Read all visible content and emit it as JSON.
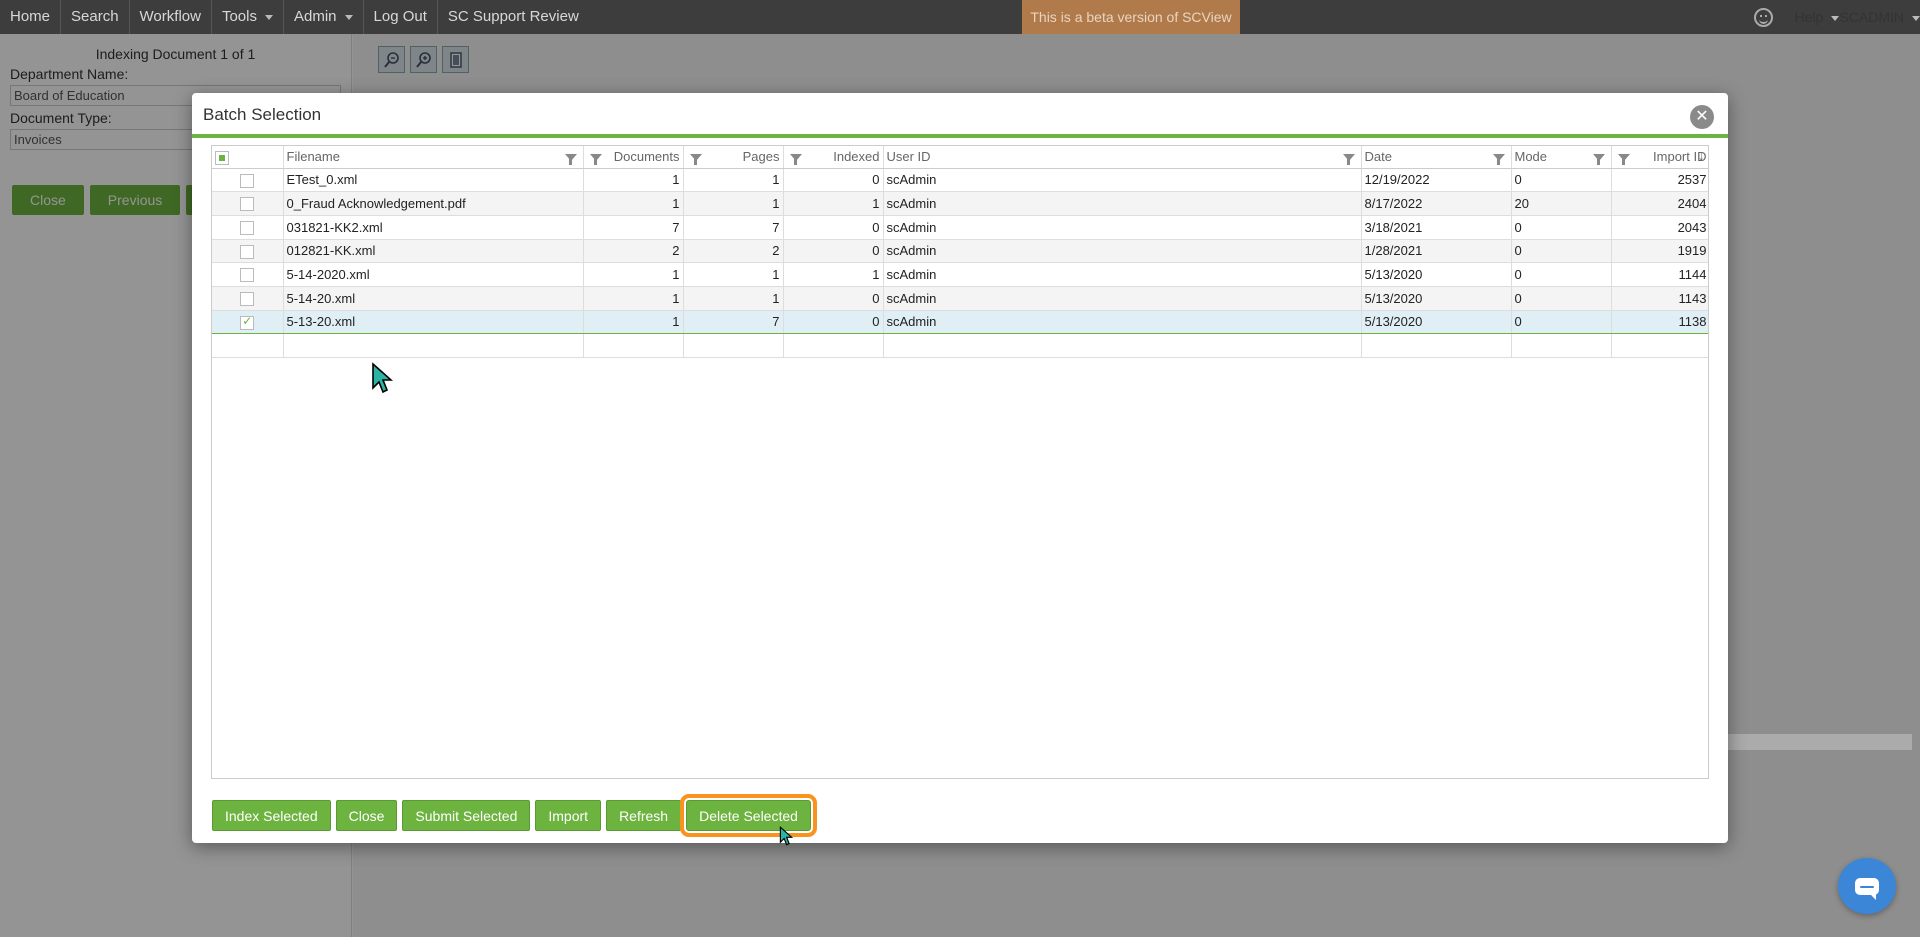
{
  "nav": {
    "items": [
      "Home",
      "Search",
      "Workflow",
      "Tools",
      "Admin",
      "Log Out",
      "SC Support Review"
    ],
    "beta_banner": "This is a beta version of SCView",
    "help": "Help",
    "user": "SCADMIN"
  },
  "left_panel": {
    "title": "Indexing Document 1 of 1",
    "department_label": "Department Name:",
    "department_value": "Board of Education",
    "doctype_label": "Document Type:",
    "doctype_value": "Invoices",
    "close_label": "Close",
    "previous_label": "Previous"
  },
  "modal": {
    "title": "Batch Selection",
    "close_icon": "close-icon",
    "columns": [
      "Filename",
      "Documents",
      "Pages",
      "Indexed",
      "User ID",
      "Date",
      "Mode",
      "Import ID"
    ],
    "rows": [
      {
        "checked": false,
        "filename": "ETest_0.xml",
        "documents": "1",
        "pages": "1",
        "indexed": "0",
        "user_id": "scAdmin",
        "date": "12/19/2022",
        "mode": "0",
        "import_id": "2537"
      },
      {
        "checked": false,
        "filename": "0_Fraud Acknowledgement.pdf",
        "documents": "1",
        "pages": "1",
        "indexed": "1",
        "user_id": "scAdmin",
        "date": "8/17/2022",
        "mode": "20",
        "import_id": "2404"
      },
      {
        "checked": false,
        "filename": "031821-KK2.xml",
        "documents": "7",
        "pages": "7",
        "indexed": "0",
        "user_id": "scAdmin",
        "date": "3/18/2021",
        "mode": "0",
        "import_id": "2043"
      },
      {
        "checked": false,
        "filename": "012821-KK.xml",
        "documents": "2",
        "pages": "2",
        "indexed": "0",
        "user_id": "scAdmin",
        "date": "1/28/2021",
        "mode": "0",
        "import_id": "1919"
      },
      {
        "checked": false,
        "filename": "5-14-2020.xml",
        "documents": "1",
        "pages": "1",
        "indexed": "1",
        "user_id": "scAdmin",
        "date": "5/13/2020",
        "mode": "0",
        "import_id": "1144"
      },
      {
        "checked": false,
        "filename": "5-14-20.xml",
        "documents": "1",
        "pages": "1",
        "indexed": "0",
        "user_id": "scAdmin",
        "date": "5/13/2020",
        "mode": "0",
        "import_id": "1143"
      },
      {
        "checked": true,
        "filename": "5-13-20.xml",
        "documents": "1",
        "pages": "7",
        "indexed": "0",
        "user_id": "scAdmin",
        "date": "5/13/2020",
        "mode": "0",
        "import_id": "1138"
      }
    ],
    "buttons": {
      "index_selected": "Index Selected",
      "close": "Close",
      "submit_selected": "Submit Selected",
      "import": "Import",
      "refresh": "Refresh",
      "delete_selected": "Delete Selected"
    }
  },
  "colors": {
    "accent_green": "#6db33f",
    "highlight_orange": "#f7931e",
    "nav_bg": "#3d3d3d",
    "chat_blue": "#3b86d6"
  }
}
